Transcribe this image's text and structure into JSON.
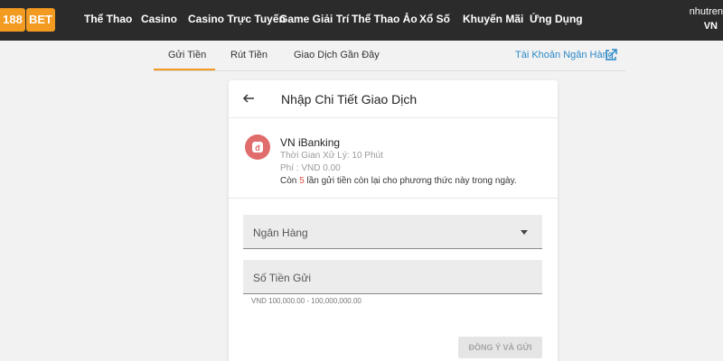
{
  "brand": {
    "logo_num": "188",
    "logo_bet": "BET",
    "accent": "#f39a21"
  },
  "nav": {
    "items": [
      {
        "label": "Thể Thao"
      },
      {
        "label": "Casino"
      },
      {
        "label": "Casino Trực Tuyến"
      },
      {
        "label": "Game Giải Trí"
      },
      {
        "label": "Thể Thao Ảo"
      },
      {
        "label": "Xổ Số"
      },
      {
        "label": "Khuyến Mãi"
      },
      {
        "label": "Ứng Dụng"
      }
    ]
  },
  "user": {
    "name": "nhutren",
    "region": "VN"
  },
  "tabs": [
    {
      "label": "Gửi Tiền",
      "active": true
    },
    {
      "label": "Rút Tiền",
      "active": false
    },
    {
      "label": "Giao Dịch Gần Đây",
      "active": false
    }
  ],
  "bank_account_link": {
    "label": "Tài Khoản Ngân Hàng",
    "icon": "external-link-icon"
  },
  "card": {
    "title": "Nhập Chi Tiết Giao Dịch",
    "method": {
      "icon": "ibanking-icon",
      "icon_glyph": "đ",
      "name": "VN iBanking",
      "processing_time": "Thời Gian Xử Lý: 10 Phút",
      "fee": "Phí : VND 0.00",
      "remaining_prefix": "Còn ",
      "remaining_count": "5",
      "remaining_suffix": " lần gửi tiền còn lại cho phương thức này trong ngày."
    },
    "bank_field": {
      "label": "Ngân Hàng"
    },
    "amount_field": {
      "label": "Số Tiền Gửi",
      "hint": "VND 100,000.00 - 100,000,000.00"
    },
    "submit_label": "ĐỒNG Ý VÀ GỬI"
  }
}
